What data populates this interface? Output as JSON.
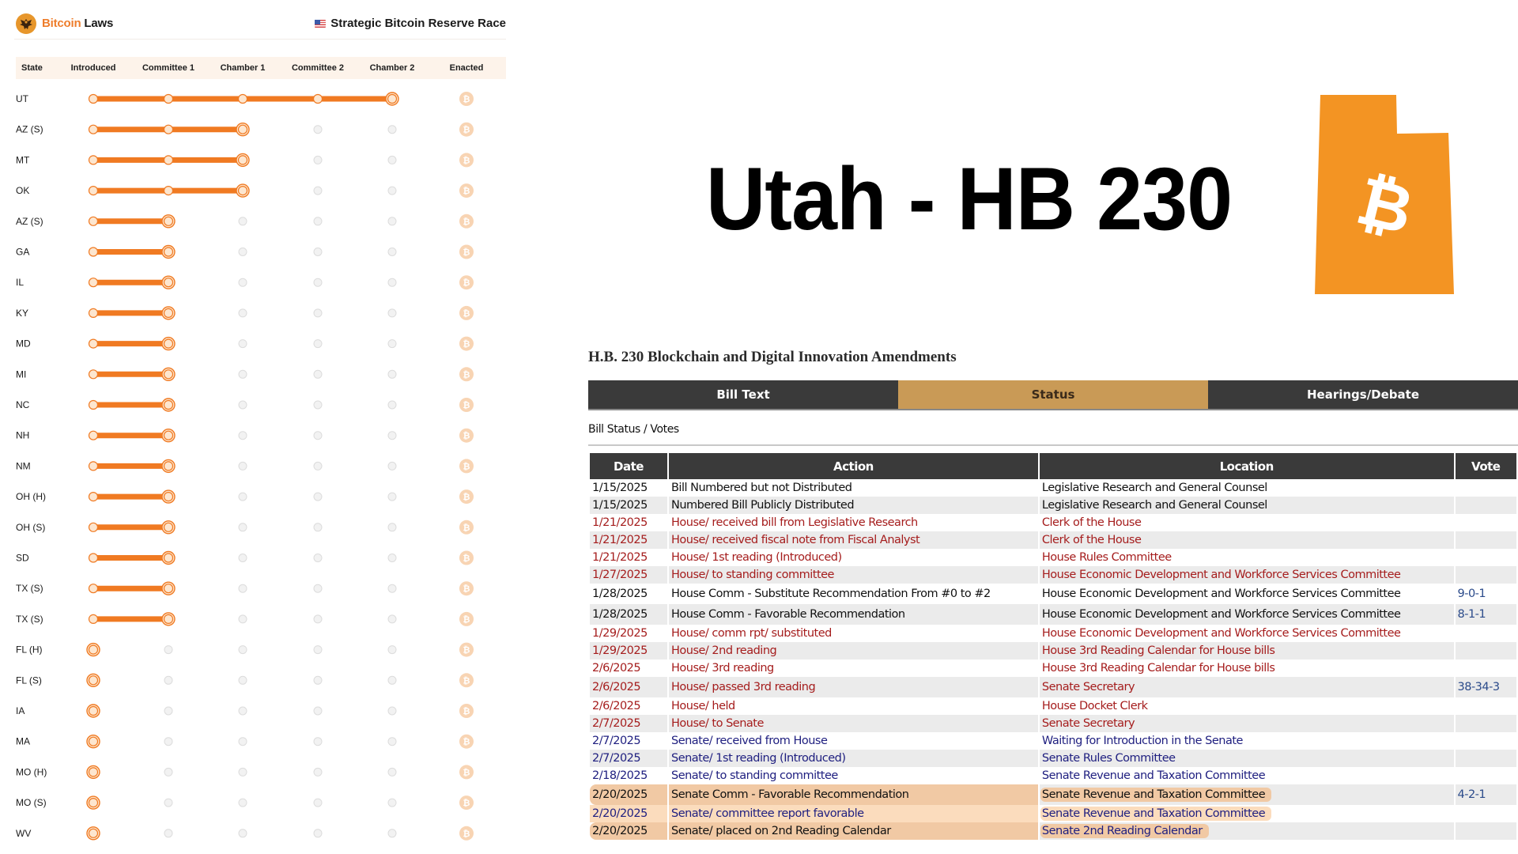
{
  "tracker": {
    "brand_part1": "Bitcoin",
    "brand_part2": "Laws",
    "race_title": "Strategic Bitcoin Reserve Race",
    "columns": [
      "State",
      "Introduced",
      "Committee 1",
      "Chamber 1",
      "Committee 2",
      "Chamber 2",
      "Enacted"
    ],
    "colors": {
      "progress": "#f07a22",
      "node_fill": "#fde6cf",
      "inactive": "#e6e6e6",
      "enacted": "#f8d4b3"
    },
    "rows": [
      {
        "state": "UT",
        "stage": 5
      },
      {
        "state": "AZ (S)",
        "stage": 3
      },
      {
        "state": "MT",
        "stage": 3
      },
      {
        "state": "OK",
        "stage": 3
      },
      {
        "state": "AZ (S)",
        "stage": 2
      },
      {
        "state": "GA",
        "stage": 2
      },
      {
        "state": "IL",
        "stage": 2
      },
      {
        "state": "KY",
        "stage": 2
      },
      {
        "state": "MD",
        "stage": 2
      },
      {
        "state": "MI",
        "stage": 2
      },
      {
        "state": "NC",
        "stage": 2
      },
      {
        "state": "NH",
        "stage": 2
      },
      {
        "state": "NM",
        "stage": 2
      },
      {
        "state": "OH (H)",
        "stage": 2
      },
      {
        "state": "OH (S)",
        "stage": 2
      },
      {
        "state": "SD",
        "stage": 2
      },
      {
        "state": "TX (S)",
        "stage": 2
      },
      {
        "state": "TX (S)",
        "stage": 2
      },
      {
        "state": "FL (H)",
        "stage": 1
      },
      {
        "state": "FL (S)",
        "stage": 1
      },
      {
        "state": "IA",
        "stage": 1
      },
      {
        "state": "MA",
        "stage": 1
      },
      {
        "state": "MO (H)",
        "stage": 1
      },
      {
        "state": "MO (S)",
        "stage": 1
      },
      {
        "state": "WV",
        "stage": 1
      }
    ]
  },
  "headline": {
    "title": "Utah - HB 230",
    "map_color": "#f39423",
    "map_icon": "bitcoin-icon"
  },
  "bill": {
    "heading": "H.B. 230 Blockchain and Digital Innovation Amendments",
    "tabs": [
      {
        "label": "Bill Text",
        "active": false
      },
      {
        "label": "Status",
        "active": true
      },
      {
        "label": "Hearings/Debate",
        "active": false
      }
    ],
    "subheading": "Bill Status / Votes",
    "columns": [
      "Date",
      "Action",
      "Location",
      "Vote"
    ],
    "rows": [
      {
        "date": "1/15/2025",
        "action": "Bill Numbered but not Distributed",
        "location": "Legislative Research and General Counsel",
        "vote": "",
        "color": "black"
      },
      {
        "date": "1/15/2025",
        "action": "Numbered Bill Publicly Distributed",
        "location": "Legislative Research and General Counsel",
        "vote": "",
        "color": "black"
      },
      {
        "date": "1/21/2025",
        "action": "House/ received bill from Legislative Research",
        "location": "Clerk of the House",
        "vote": "",
        "color": "red"
      },
      {
        "date": "1/21/2025",
        "action": "House/ received fiscal note from Fiscal Analyst",
        "location": "Clerk of the House",
        "vote": "",
        "color": "red"
      },
      {
        "date": "1/21/2025",
        "action": "House/ 1st reading (Introduced)",
        "location": "House Rules Committee",
        "vote": "",
        "color": "red"
      },
      {
        "date": "1/27/2025",
        "action": "House/ to standing committee",
        "location": "House Economic Development and Workforce Services Committee",
        "vote": "",
        "color": "red"
      },
      {
        "date": "1/28/2025",
        "action": "House Comm - Substitute Recommendation From #0 to #2",
        "location": "House Economic Development and Workforce Services Committee",
        "vote": "9-0-1",
        "color": "black",
        "tall": true
      },
      {
        "date": "1/28/2025",
        "action": "House Comm - Favorable Recommendation",
        "location": "House Economic Development and Workforce Services Committee",
        "vote": "8-1-1",
        "color": "black",
        "tall": true
      },
      {
        "date": "1/29/2025",
        "action": "House/ comm rpt/ substituted",
        "location": "House Economic Development and Workforce Services Committee",
        "vote": "",
        "color": "red"
      },
      {
        "date": "1/29/2025",
        "action": "House/ 2nd reading",
        "location": "House 3rd Reading Calendar for House bills",
        "vote": "",
        "color": "red"
      },
      {
        "date": "2/6/2025",
        "action": "House/ 3rd reading",
        "location": "House 3rd Reading Calendar for House bills",
        "vote": "",
        "color": "red"
      },
      {
        "date": "2/6/2025",
        "action": "House/ passed 3rd reading",
        "location": "Senate Secretary",
        "vote": "38-34-3",
        "color": "red",
        "tall": true
      },
      {
        "date": "2/6/2025",
        "action": "House/ held",
        "location": "House Docket Clerk",
        "vote": "",
        "color": "red"
      },
      {
        "date": "2/7/2025",
        "action": "House/ to Senate",
        "location": "Senate Secretary",
        "vote": "",
        "color": "red"
      },
      {
        "date": "2/7/2025",
        "action": "Senate/ received from House",
        "location": "Waiting for Introduction in the Senate",
        "vote": "",
        "color": "blue"
      },
      {
        "date": "2/7/2025",
        "action": "Senate/ 1st reading (Introduced)",
        "location": "Senate Rules Committee",
        "vote": "",
        "color": "blue"
      },
      {
        "date": "2/18/2025",
        "action": "Senate/ to standing committee",
        "location": "Senate Revenue and Taxation Committee",
        "vote": "",
        "color": "blue"
      },
      {
        "date": "2/20/2025",
        "action": "Senate Comm - Favorable Recommendation",
        "location": "Senate Revenue and Taxation Committee",
        "vote": "4-2-1",
        "color": "black",
        "tall": true,
        "highlight": "strong"
      },
      {
        "date": "2/20/2025",
        "action": "Senate/ committee report favorable",
        "location": "Senate Revenue and Taxation Committee",
        "vote": "",
        "color": "blue",
        "highlight": "light"
      },
      {
        "date": "2/20/2025",
        "action": "Senate/ placed on 2nd Reading Calendar",
        "location": "Senate 2nd Reading Calendar",
        "vote": "",
        "color": "blue",
        "highlight": "strong"
      }
    ]
  }
}
